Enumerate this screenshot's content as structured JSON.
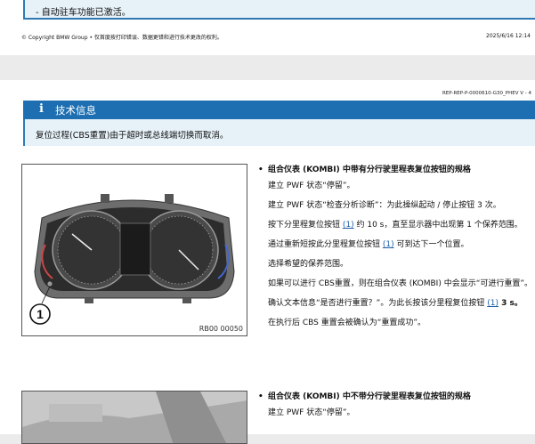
{
  "page1": {
    "notice": "- 自动驻车功能已激活。",
    "footer_left": "© Copyright BMW Group • 仅首度按打印错误、数据更错和进行技术更改的权利。",
    "footer_right": "2025/6/16 12:14"
  },
  "page2": {
    "docref": "REP-REP-P-0000610-G30_PHEV V - 4",
    "info": {
      "icon": "i",
      "title": "技术信息",
      "body": "复位过程(CBS重置)由于超时或总线端切换而取消。"
    },
    "figure1": {
      "callout": "1",
      "label": "RB00 00050"
    },
    "section1": {
      "heading": "组合仪表 (KOMBI) 中带有分行驶里程表复位按钮的规格",
      "p1": "建立 PWF 状态“停留”。",
      "p2": "建立 PWF 状态“检查分析诊断”：为此操纵起动 / 停止按钮 3 次。",
      "p3a": "按下分里程复位按钮 ",
      "p3_link": "(1)",
      "p3b": " 约 10 s，直至显示器中出现第 1 个保养范围。",
      "p4a": "通过重新短按此分里程复位按钮 ",
      "p4_link": "(1)",
      "p4b": " 可到达下一个位置。",
      "p5": "选择希望的保养范围。",
      "p6": "如果可以进行 CBS重置，则在组合仪表 (KOMBI) 中会显示“可进行重置”。",
      "p7a": "确认文本信息“是否进行重置？”。为此长按该分里程复位按钮 ",
      "p7_link": "(1)",
      "p7b": " 3 s。",
      "p8": "在执行后 CBS 重置会被确认为“重置成功”。"
    },
    "section2": {
      "heading": "组合仪表 (KOMBI) 中不带分行驶里程表复位按钮的规格",
      "p1": "建立 PWF 状态“停留”。"
    }
  }
}
